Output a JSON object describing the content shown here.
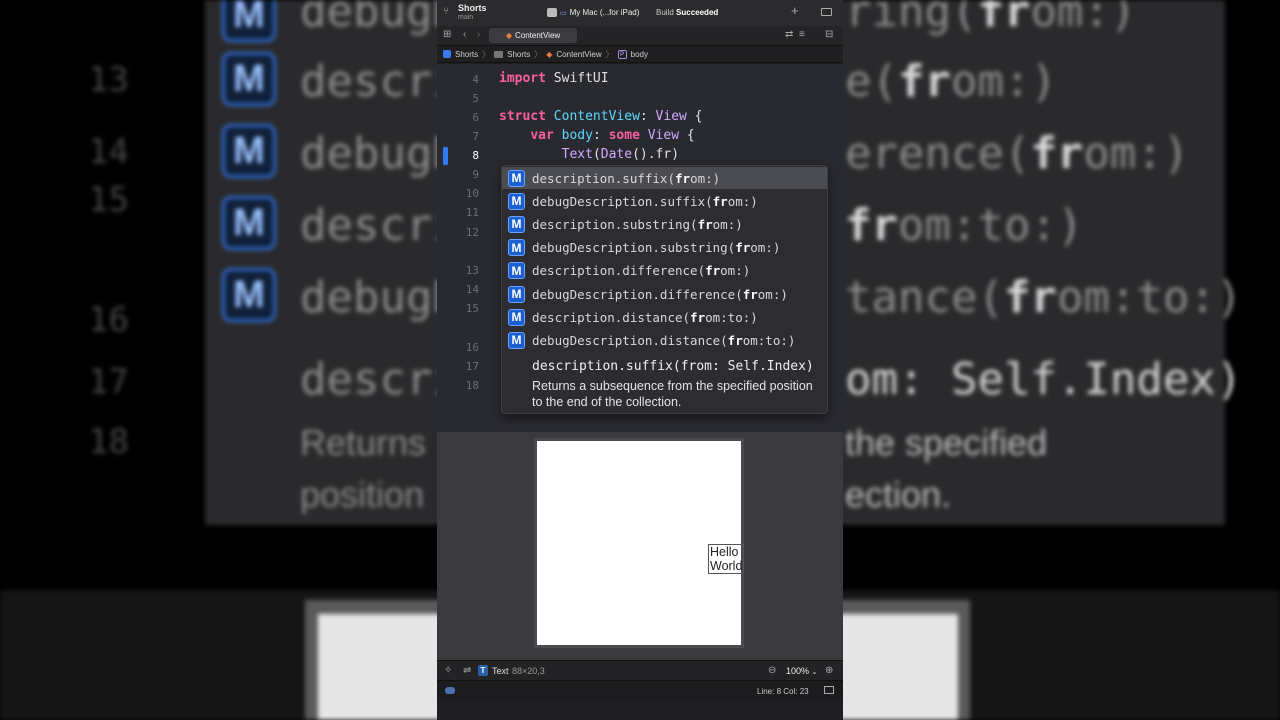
{
  "titlebar": {
    "project": "Shorts",
    "branch": "main",
    "scheme_target": "My Mac (...for iPad)",
    "build_status_prefix": "Build",
    "build_status": "Succeeded"
  },
  "tab": {
    "label": "ContentView"
  },
  "breadcrumb": [
    "Shorts",
    "Shorts",
    "ContentView",
    "body"
  ],
  "breadcrumb_badge": "P",
  "editor": {
    "current_line": 8,
    "lines": [
      {
        "n": "4",
        "code": [
          [
            "import",
            "kw"
          ],
          [
            " SwiftUI",
            ""
          ]
        ]
      },
      {
        "n": "5",
        "code": []
      },
      {
        "n": "6",
        "code": [
          [
            "struct",
            "kw"
          ],
          [
            " ",
            ""
          ],
          [
            "ContentView",
            "ty"
          ],
          [
            ": ",
            ""
          ],
          [
            "View",
            "ty2"
          ],
          [
            " {",
            ""
          ]
        ]
      },
      {
        "n": "7",
        "code": [
          [
            "    ",
            ""
          ],
          [
            "var",
            "kw"
          ],
          [
            " ",
            ""
          ],
          [
            "body",
            "ty"
          ],
          [
            ": ",
            ""
          ],
          [
            "some",
            "kw"
          ],
          [
            " ",
            ""
          ],
          [
            "View",
            "ty2"
          ],
          [
            " {",
            ""
          ]
        ]
      },
      {
        "n": "8",
        "code": [
          [
            "        ",
            ""
          ],
          [
            "Text",
            "ty2"
          ],
          [
            "(",
            ""
          ],
          [
            "Date",
            "ty2"
          ],
          [
            "().fr)",
            ""
          ]
        ]
      }
    ],
    "hidden_line_numbers": [
      "9",
      "10",
      "11",
      "12",
      "13",
      "14",
      "15",
      "16",
      "17",
      "18"
    ]
  },
  "completion": {
    "badge": "M",
    "items": [
      {
        "pre": "description.suffix(",
        "bold": "fr",
        "post": "om:)"
      },
      {
        "pre": "debugDescription.suffix(",
        "bold": "fr",
        "post": "om:)"
      },
      {
        "pre": "description.substring(",
        "bold": "fr",
        "post": "om:)"
      },
      {
        "pre": "debugDescription.substring(",
        "bold": "fr",
        "post": "om:)"
      },
      {
        "pre": "description.difference(",
        "bold": "fr",
        "post": "om:)"
      },
      {
        "pre": "debugDescription.difference(",
        "bold": "fr",
        "post": "om:)"
      },
      {
        "pre": "description.distance(",
        "bold": "fr",
        "post": "om:to:)"
      },
      {
        "pre": "debugDescription.distance(",
        "bold": "fr",
        "post": "om:to:)"
      }
    ],
    "doc_signature": "description.suffix(from: Self.Index)",
    "doc_description": "Returns a subsequence from the specified position to the end of the collection."
  },
  "preview": {
    "text": "Hello World"
  },
  "statusbar": {
    "element_badge": "T",
    "element_type": "Text",
    "element_size": "88×20,3",
    "zoom": "100%"
  },
  "bottombar": {
    "cursor": "Line: 8  Col: 23"
  },
  "colors": {
    "keyword": "#fc5fa3",
    "type": "#d0a8ff",
    "declaration": "#5dd8ff",
    "accent": "#2f7af5"
  }
}
